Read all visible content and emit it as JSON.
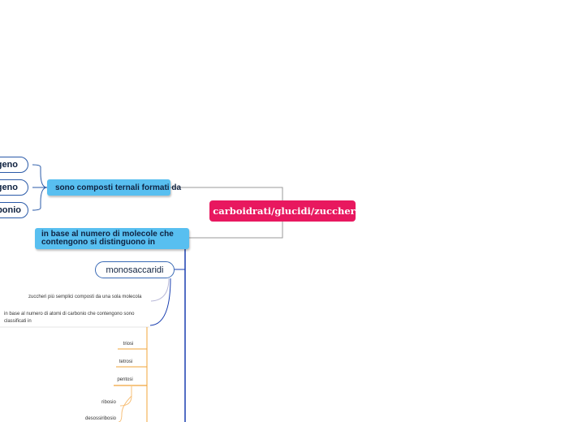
{
  "root": {
    "label": "i carboidrati/glucidi/zuccheri"
  },
  "branches": {
    "composti": {
      "label": "sono composti ternali formati da",
      "children": [
        "geno",
        "geno",
        "bonio"
      ]
    },
    "classificazione": {
      "line1": "in base al numero di molecole che",
      "line2": "contengono si distinguono in"
    }
  },
  "monosaccaridi": {
    "label": "monosaccaridi",
    "note1": "zuccheri più semplici composti da una sola molecola",
    "note2": "in base al numero di atomi di carbonio che contengono sono classificati in",
    "types": [
      "triosi",
      "tetrosi",
      "pentosi"
    ],
    "pentosi_children": [
      "ribosio",
      "desossiribosio"
    ]
  },
  "colors": {
    "root": "#e8185f",
    "branch": "#58bff0",
    "outline": "#2a5aa8",
    "connector_gray": "#9a9a9a",
    "connector_orange": "#f0a43a",
    "connector_blue": "#1a3fb0"
  }
}
